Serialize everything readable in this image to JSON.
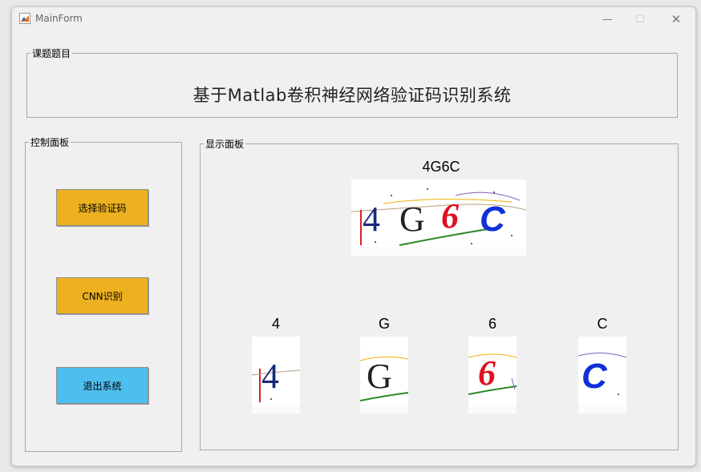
{
  "window": {
    "title": "MainForm",
    "controls": {
      "minimize": "—",
      "maximize": "☐",
      "close": "✕"
    }
  },
  "title_panel": {
    "legend": "课题题目",
    "heading": "基于Matlab卷积神经网络验证码识别系统"
  },
  "control_panel": {
    "legend": "控制面板",
    "buttons": [
      {
        "label": "选择验证码",
        "color": "#edb120"
      },
      {
        "label": "CNN识别",
        "color": "#edb120"
      },
      {
        "label": "退出系统",
        "color": "#4dbeee"
      }
    ]
  },
  "display_panel": {
    "legend": "显示面板",
    "captcha_text": "4G6C",
    "characters": [
      "4",
      "G",
      "6",
      "C"
    ]
  }
}
